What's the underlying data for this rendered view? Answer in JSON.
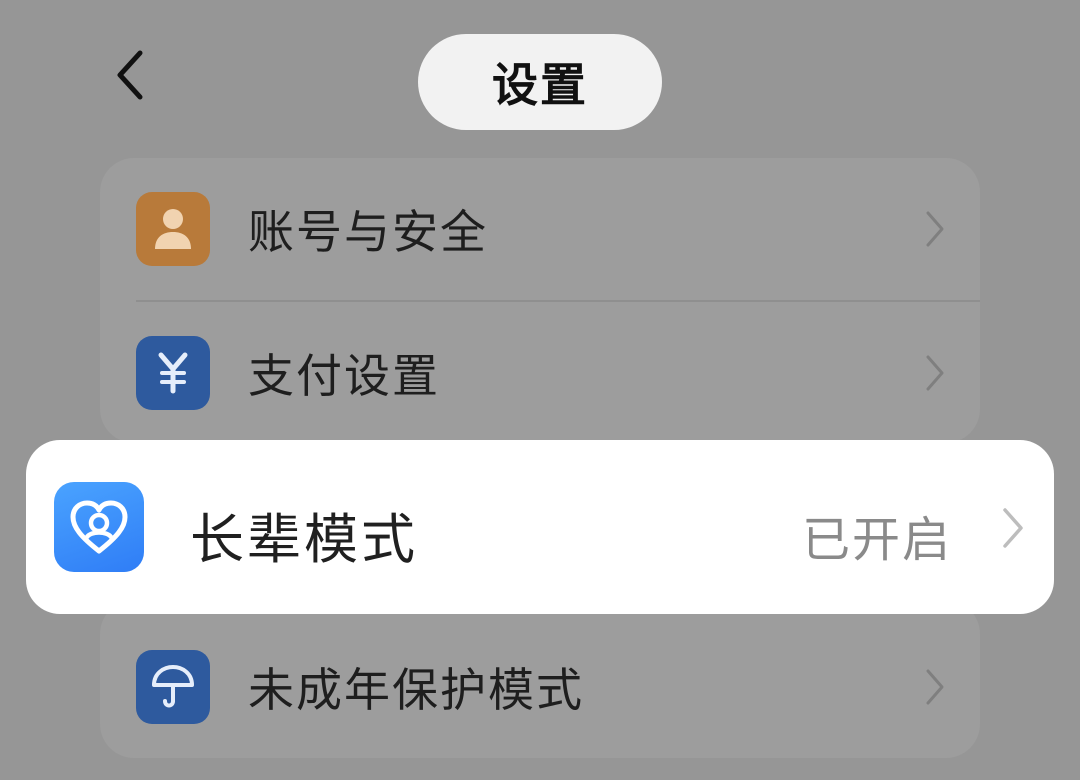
{
  "header": {
    "title": "设置",
    "back_icon": "chevron-left-icon"
  },
  "settings": {
    "items": [
      {
        "label": "账号与安全",
        "icon": "user-icon",
        "icon_color": "#b87a3a"
      },
      {
        "label": "支付设置",
        "icon": "yen-icon",
        "icon_color": "#2e5a9e"
      },
      {
        "label": "长辈模式",
        "status": "已开启",
        "icon": "heart-person-icon",
        "icon_color": "#3b8df8"
      },
      {
        "label": "未成年保护模式",
        "icon": "umbrella-icon",
        "icon_color": "#2e5a9e"
      }
    ]
  },
  "colors": {
    "overlay_bg": "#969696",
    "card_bg": "#9d9d9d",
    "highlight_bg": "#ffffff",
    "accent_blue": "#3b8df8"
  }
}
